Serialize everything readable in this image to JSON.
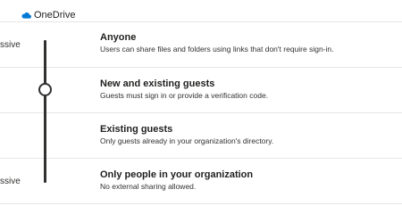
{
  "app": {
    "name": "OneDrive",
    "icon": "cloud-icon",
    "brand_color": "#0078d4"
  },
  "slider": {
    "left_labels": {
      "top": "ssive",
      "bottom": "ssive"
    },
    "selected_index": 1
  },
  "options": [
    {
      "title": "Anyone",
      "description": "Users can share files and folders using links that don't require sign-in."
    },
    {
      "title": "New and existing guests",
      "description": "Guests must sign in or provide a verification code."
    },
    {
      "title": "Existing guests",
      "description": "Only guests already in your organization's directory."
    },
    {
      "title": "Only people in your organization",
      "description": "No external sharing allowed."
    }
  ]
}
